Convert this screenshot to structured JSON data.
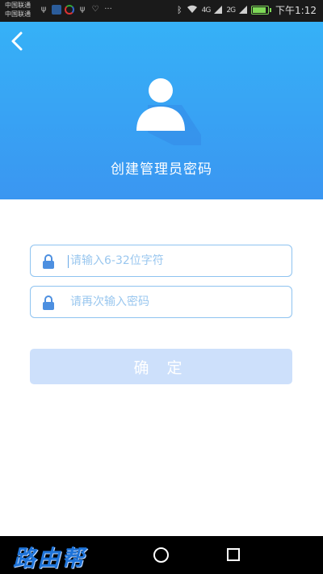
{
  "status_bar": {
    "carrier_1": "中国联通",
    "carrier_2": "中国联通",
    "more": "···",
    "network_4g": "4G",
    "network_2g": "2G",
    "time": "下午1:12"
  },
  "header": {
    "title": "创建管理员密码"
  },
  "form": {
    "password_placeholder": "请输入6-32位字符",
    "confirm_placeholder": "请再次输入密码",
    "submit_label": "确 定"
  },
  "nav": {
    "brand": "路由帮"
  },
  "colors": {
    "header_top": "#36b1f7",
    "header_bottom": "#3a96f1",
    "field_border": "#8ec3f0",
    "button_bg": "#cde0fb"
  }
}
